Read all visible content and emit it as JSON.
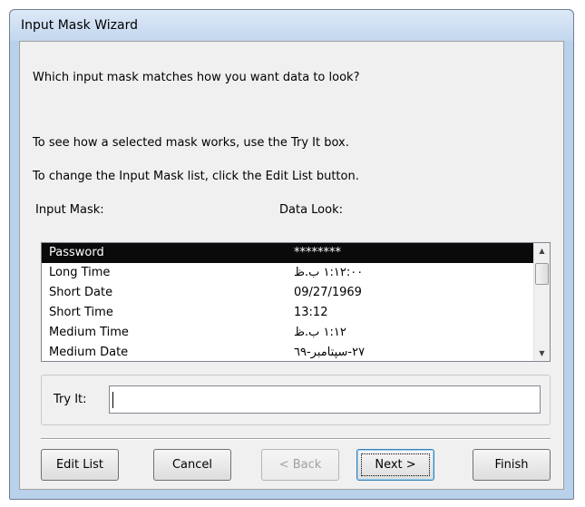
{
  "window": {
    "title": "Input Mask Wizard"
  },
  "intro": {
    "question": "Which input mask matches how you want data to look?",
    "tryit_hint": "To see how a selected mask works, use the Try It box.",
    "editlist_hint": "To change the Input Mask list, click the Edit List button."
  },
  "list": {
    "col_mask": "Input Mask:",
    "col_look": "Data Look:",
    "rows": [
      {
        "mask": "Password",
        "look": "********",
        "selected": true
      },
      {
        "mask": "Long Time",
        "look": "١:١٢:٠٠ ب.ظ"
      },
      {
        "mask": "Short Date",
        "look": "09/27/1969"
      },
      {
        "mask": "Short Time",
        "look": "13:12"
      },
      {
        "mask": "Medium Time",
        "look": "١:١٢ ب.ظ"
      },
      {
        "mask": "Medium Date",
        "look": "٢٧-سپتامبر-٦٩"
      }
    ]
  },
  "tryit": {
    "label": "Try It:",
    "value": ""
  },
  "buttons": {
    "edit_list": "Edit List",
    "cancel": "Cancel",
    "back": "< Back",
    "next": "Next >",
    "finish": "Finish"
  }
}
